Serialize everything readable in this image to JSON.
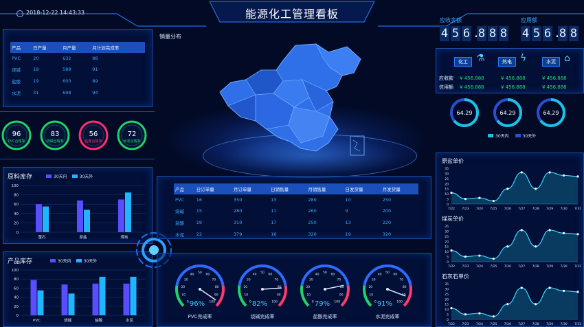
{
  "header": {
    "title": "能源化工管理看板",
    "datetime": "2018-12-22 14:43:33"
  },
  "production_table": {
    "headers": [
      "产品",
      "日产量",
      "月产量",
      "月计划完成率"
    ],
    "rows": [
      [
        "PVC",
        "20",
        "632",
        "88"
      ],
      [
        "烧碱",
        "18",
        "588",
        "91"
      ],
      [
        "盐酸",
        "19",
        "603",
        "89"
      ],
      [
        "水泥",
        "31",
        "698",
        "94"
      ]
    ]
  },
  "rates": [
    {
      "value": "96",
      "label": "PVC合格率",
      "color": "#1fd36a"
    },
    {
      "value": "83",
      "label": "烧碱合格率",
      "color": "#1fd36a"
    },
    {
      "value": "56",
      "label": "盐酸合格率",
      "color": "#ff2f6d"
    },
    {
      "value": "72",
      "label": "水泥合格率",
      "color": "#1fd36a"
    }
  ],
  "raw_stock": {
    "title": "原料库存",
    "legend": [
      "30天内",
      "30天外"
    ],
    "colors": [
      "#5a4dff",
      "#1fb6ff"
    ],
    "chart_data": {
      "type": "bar",
      "categories": [
        "萤石",
        "原盐",
        "煤炭"
      ],
      "series": [
        {
          "name": "30天内",
          "values": [
            60,
            68,
            70
          ]
        },
        {
          "name": "30天外",
          "values": [
            55,
            48,
            85
          ]
        }
      ],
      "yticks": [
        0,
        20,
        40,
        60,
        80,
        100
      ],
      "ylim": [
        0,
        100
      ]
    }
  },
  "product_stock": {
    "title": "产品库存",
    "legend": [
      "30天内",
      "30天外"
    ],
    "colors": [
      "#5a4dff",
      "#1fb6ff"
    ],
    "chart_data": {
      "type": "bar",
      "categories": [
        "PVC",
        "烧碱",
        "盐酸",
        "水泥"
      ],
      "series": [
        {
          "name": "30天内",
          "values": [
            78,
            68,
            70,
            70
          ]
        },
        {
          "name": "30天外",
          "values": [
            55,
            48,
            85,
            85
          ]
        }
      ],
      "yticks": [
        0,
        20,
        40,
        60,
        80,
        100
      ],
      "ylim": [
        0,
        100
      ]
    }
  },
  "map": {
    "title": "销量分布"
  },
  "sales_table": {
    "headers": [
      "产品",
      "日订单量",
      "月订单量",
      "日销售量",
      "月销售量",
      "日发货量",
      "月发货量"
    ],
    "rows": [
      [
        "PVC",
        "16",
        "350",
        "13",
        "280",
        "10",
        "250"
      ],
      [
        "烧碱",
        "15",
        "280",
        "11",
        "260",
        "9",
        "200"
      ],
      [
        "盐酸",
        "19",
        "310",
        "17",
        "250",
        "13",
        "220"
      ],
      [
        "水泥",
        "22",
        "379",
        "16",
        "320",
        "19",
        "320"
      ]
    ]
  },
  "gauges": {
    "ticks": [
      "0",
      "10",
      "20",
      "30",
      "40",
      "50",
      "60",
      "70",
      "80",
      "90",
      "100"
    ],
    "items": [
      {
        "value": 96,
        "text": "96%",
        "label": "PVC完成率"
      },
      {
        "value": 82,
        "text": "82%",
        "label": "烧碱完成率"
      },
      {
        "value": 79,
        "text": "79%",
        "label": "盐酸完成率"
      },
      {
        "value": 91,
        "text": "91%",
        "label": "水泥完成率"
      }
    ]
  },
  "receivables": {
    "label_ys": "应收金额",
    "label_yy": "应用额",
    "ys_digits": [
      "4",
      "5",
      "6",
      ".",
      "8",
      "8",
      "8"
    ],
    "yy_digits": [
      "4",
      "5",
      "6",
      ".",
      "8",
      "8"
    ]
  },
  "categories": [
    {
      "name": "化工",
      "icon": "flask-icon"
    },
    {
      "name": "热电",
      "icon": "lightning-icon"
    },
    {
      "name": "水泥",
      "icon": "cement-icon"
    }
  ],
  "money": {
    "row_labels": [
      "应收款",
      "信用额"
    ],
    "values": [
      [
        "¥ 456.888",
        "¥ 456.888",
        "¥ 456.888"
      ],
      [
        "¥ 456.888",
        "¥ 456.888",
        "¥ 456.888"
      ]
    ]
  },
  "rings": {
    "values": [
      "64.29",
      "64.29",
      "64.29"
    ],
    "legend": [
      "30天内",
      "30天外"
    ],
    "colors": [
      "#19c3e6",
      "#2a4fd1"
    ]
  },
  "line_charts": [
    {
      "title": "原盐单价",
      "chart_data": {
        "type": "area",
        "x": [
          "7/22",
          "7/23",
          "7/24",
          "7/25",
          "7/26",
          "7/27",
          "7/28",
          "7/29",
          "7/30",
          "7/31"
        ],
        "values": [
          11,
          5,
          6,
          3,
          15,
          31,
          15,
          31,
          28,
          27
        ],
        "yticks": [
          0,
          5,
          10,
          15,
          20,
          25,
          30,
          35
        ],
        "ylim": [
          0,
          35
        ]
      }
    },
    {
      "title": "煤炭单价",
      "chart_data": {
        "type": "area",
        "x": [
          "7/22",
          "7/23",
          "7/24",
          "7/25",
          "7/26",
          "7/27",
          "7/28",
          "7/29",
          "7/30",
          "7/31"
        ],
        "values": [
          11,
          5,
          6,
          3,
          15,
          31,
          15,
          31,
          28,
          27
        ],
        "yticks": [
          0,
          5,
          10,
          15,
          20,
          25,
          30,
          35
        ],
        "ylim": [
          0,
          35
        ]
      }
    },
    {
      "title": "石灰石单价",
      "chart_data": {
        "type": "area",
        "x": [
          "7/22",
          "7/23",
          "7/24",
          "7/25",
          "7/26",
          "7/27",
          "7/28",
          "7/29",
          "7/30",
          "7/31"
        ],
        "values": [
          11,
          5,
          6,
          3,
          15,
          31,
          15,
          31,
          28,
          27
        ],
        "yticks": [
          0,
          5,
          10,
          15,
          20,
          25,
          30,
          35
        ],
        "ylim": [
          0,
          35
        ]
      }
    }
  ]
}
